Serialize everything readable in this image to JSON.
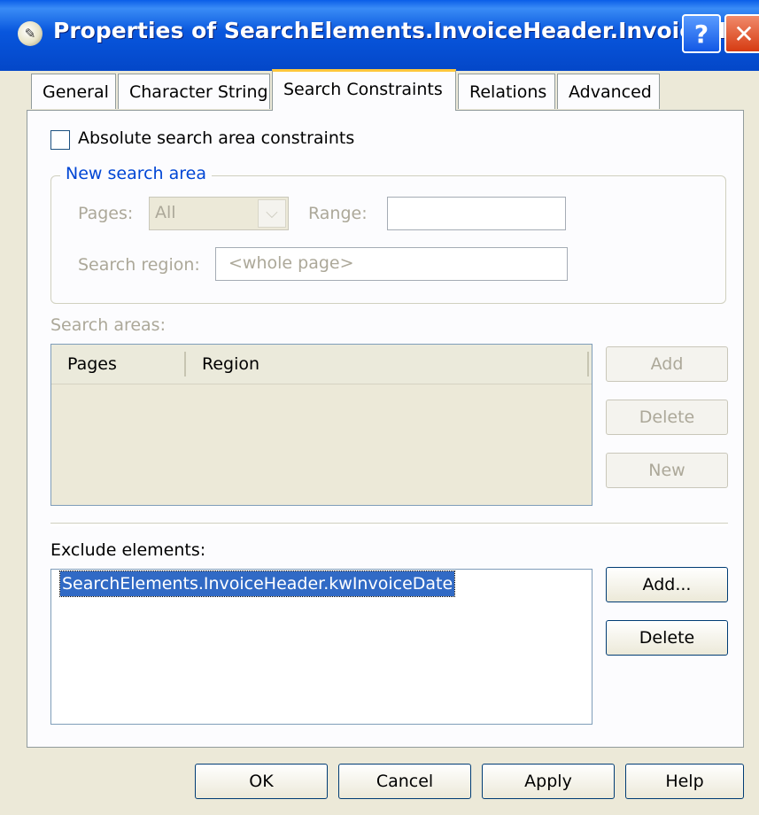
{
  "window": {
    "title": "Properties of SearchElements.InvoiceHeader.InvoiceN...",
    "help_label": "?",
    "close_label": "✕"
  },
  "tabs": [
    {
      "label": "General",
      "active": false
    },
    {
      "label": "Character String",
      "active": false
    },
    {
      "label": "Search Constraints",
      "active": true
    },
    {
      "label": "Relations",
      "active": false
    },
    {
      "label": "Advanced",
      "active": false
    }
  ],
  "constraints": {
    "absolute_checkbox_label": "Absolute search area constraints",
    "absolute_checked": false
  },
  "new_search_area": {
    "title": "New search area",
    "pages_label": "Pages:",
    "pages_value": "All",
    "range_label": "Range:",
    "range_value": "",
    "region_label": "Search region:",
    "region_value": "<whole page>"
  },
  "search_areas": {
    "label": "Search areas:",
    "columns": [
      "Pages",
      "Region"
    ],
    "rows": [],
    "buttons": {
      "add": "Add",
      "delete": "Delete",
      "new": "New"
    }
  },
  "exclude": {
    "label": "Exclude elements:",
    "items": [
      "SearchElements.InvoiceHeader.kwInvoiceDate"
    ],
    "buttons": {
      "add": "Add...",
      "delete": "Delete"
    }
  },
  "footer": {
    "ok": "OK",
    "cancel": "Cancel",
    "apply": "Apply",
    "help": "Help"
  },
  "colors": {
    "titlebar": "#0a5ee8",
    "selection": "#316ac5",
    "group_title": "#0046d5",
    "disabled_text": "#aca899"
  }
}
